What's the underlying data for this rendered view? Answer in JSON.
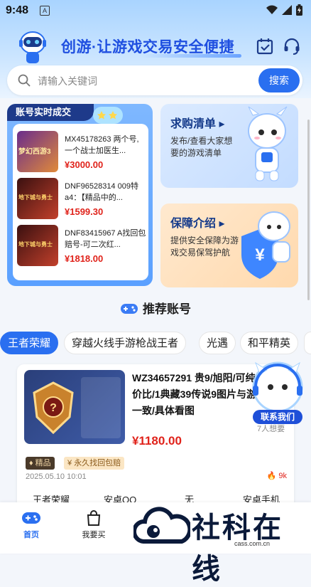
{
  "status_bar": {
    "time": "9:48",
    "notif_letter": "A"
  },
  "header": {
    "title": "创游·让游戏交易安全便捷"
  },
  "search": {
    "placeholder": "请输入关键词",
    "button": "搜索"
  },
  "realtime": {
    "heading": "账号实时成交",
    "deals": [
      {
        "title": "MX45178263 两个号,一个战士加医生...",
        "price": "¥3000.00",
        "game": "梦幻西游3"
      },
      {
        "title": "DNF96528314 009特a4：【精品中的...",
        "price": "¥1599.30",
        "game": "地下城与勇士"
      },
      {
        "title": "DNF83415967 A找回包赔号-可二次红...",
        "price": "¥1818.00",
        "game": "地下城与勇士"
      }
    ]
  },
  "buy_card": {
    "title": "求购清单",
    "desc": "发布/查看大家想要的游戏清单"
  },
  "safe_card": {
    "title": "保障介绍",
    "desc": "提供安全保障为游戏交易保驾护航"
  },
  "recommend": {
    "title": "推荐账号"
  },
  "tabs": [
    "王者荣耀",
    "穿越火线手游枪战王者",
    "光遇",
    "和平精英"
  ],
  "account": {
    "title": "WZ34657291 贵9/旭阳/可纯性价比/1典藏39传说9图片与游戏一致/具体看图",
    "price": "¥1180.00",
    "tags": [
      "精品",
      "永久找回包赔"
    ],
    "date": "2025.05.10 10:01",
    "want": "7人想要",
    "hot": "9k",
    "specs": [
      "王者荣耀",
      "安卓QQ",
      "无",
      "安卓手机"
    ]
  },
  "float_button": {
    "label": "联系我们"
  },
  "bottom_nav": [
    {
      "label": "首页",
      "icon": "gamepad-icon"
    },
    {
      "label": "我要买",
      "icon": "bag-icon"
    }
  ],
  "watermark": {
    "text": "社科在线",
    "url": "cass.com.cn"
  },
  "colors": {
    "accent": "#2a6ff0",
    "price": "#e0231b",
    "navy": "#143a8a"
  }
}
